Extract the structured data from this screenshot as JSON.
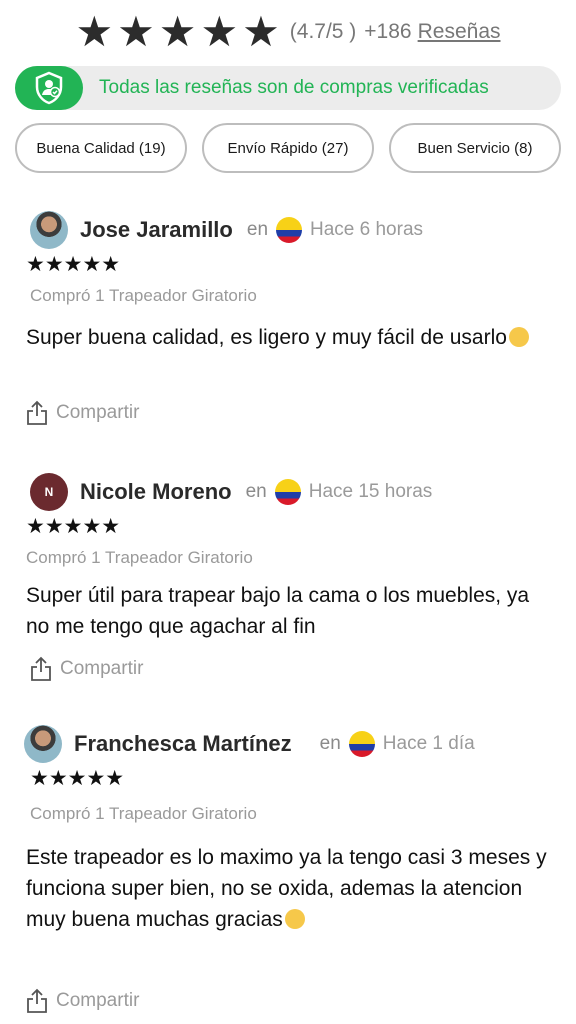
{
  "header": {
    "stars": [
      "★",
      "★",
      "★",
      "★",
      "★"
    ],
    "rating": "(4.7/5 )",
    "count": "+186",
    "reviews_link": "Reseñas"
  },
  "verified": {
    "text": "Todas las reseñas son de compras verificadas",
    "icon": "shield-user-check-icon",
    "color": "#22b455"
  },
  "tags": [
    {
      "label": "Buena Calidad (19)"
    },
    {
      "label": "Envío Rápido (27)"
    },
    {
      "label": "Buen Servicio (8)"
    }
  ],
  "reviews": [
    {
      "name": "Jose Jaramillo",
      "avatar": "photo",
      "en": "en",
      "flag": "colombia-flag-icon",
      "time": "Hace 6 horas",
      "stars": "★★★★★",
      "purchase": "Compró 1 Trapeador Giratorio",
      "text": "Super buena calidad, es ligero y muy fácil de usarlo",
      "emoji": "ok-hand-emoji",
      "share": "Compartir"
    },
    {
      "name": "Nicole Moreno",
      "avatar_initial": "N",
      "en": "en",
      "flag": "colombia-flag-icon",
      "time": "Hace 15 horas",
      "stars": "★★★★★",
      "purchase": "Compró 1 Trapeador Giratorio",
      "text": "Super útil para trapear bajo la cama o los muebles, ya no me tengo que agachar al fin",
      "share": "Compartir"
    },
    {
      "name": "Franchesca Martínez",
      "avatar": "photo",
      "en": "en",
      "flag": "colombia-flag-icon",
      "time": "Hace 1 día",
      "stars": "★★★★★",
      "purchase": "Compró 1 Trapeador Giratorio",
      "text": "Este trapeador es lo maximo ya la tengo casi 3 meses y funciona super bien, no se oxida, ademas la atencion muy buena muchas gracias",
      "emoji": "smiling-face-emoji",
      "share": "Compartir"
    }
  ]
}
